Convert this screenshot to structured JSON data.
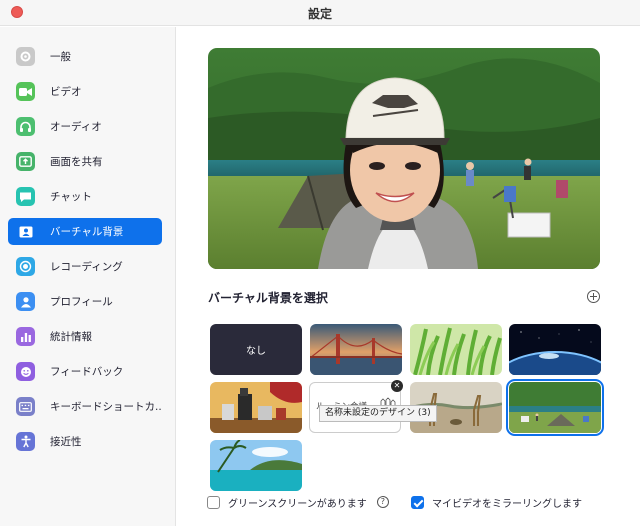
{
  "window": {
    "title": "設定"
  },
  "sidebar": {
    "items": [
      {
        "label": "一般",
        "icon": "gear-icon",
        "color": "#c9c9c9"
      },
      {
        "label": "ビデオ",
        "icon": "video-camera-icon",
        "color": "#55c359"
      },
      {
        "label": "オーディオ",
        "icon": "headphones-icon",
        "color": "#4dbf70"
      },
      {
        "label": "画面を共有",
        "icon": "share-screen-icon",
        "color": "#46b36a"
      },
      {
        "label": "チャット",
        "icon": "chat-bubble-icon",
        "color": "#27c3b1"
      },
      {
        "label": "バーチャル背景",
        "icon": "person-card-icon",
        "color": "#0e71eb"
      },
      {
        "label": "レコーディング",
        "icon": "record-icon",
        "color": "#2ea8e6"
      },
      {
        "label": "プロフィール",
        "icon": "profile-icon",
        "color": "#3c8ff2"
      },
      {
        "label": "統計情報",
        "icon": "statistics-icon",
        "color": "#9a68e0"
      },
      {
        "label": "フィードバック",
        "icon": "feedback-smile-icon",
        "color": "#8f5fe0"
      },
      {
        "label": "キーボードショートカ...",
        "icon": "keyboard-icon",
        "color": "#7a80c9"
      },
      {
        "label": "接近性",
        "icon": "accessibility-icon",
        "color": "#6674d6"
      }
    ],
    "active_index": 5
  },
  "main": {
    "section_title": "バーチャル背景を選択",
    "backgrounds": [
      {
        "label": "なし",
        "kind": "none"
      },
      {
        "label": "",
        "kind": "golden-gate-bridge"
      },
      {
        "label": "",
        "kind": "grass"
      },
      {
        "label": "",
        "kind": "earth-from-space"
      },
      {
        "label": "",
        "kind": "camping-coffee"
      },
      {
        "label": "ルーミン会議",
        "kind": "custom-design"
      },
      {
        "label": "",
        "kind": "savanna-giraffes"
      },
      {
        "label": "",
        "kind": "campsite-selected"
      },
      {
        "label": "",
        "kind": "tropical-beach"
      }
    ],
    "selected_index": 7,
    "tooltip": "名称未設定のデザイン (3)",
    "remove_glyph": "✕"
  },
  "options": {
    "green_screen_label": "グリーンスクリーンがあります",
    "green_screen_checked": false,
    "mirror_label": "マイビデオをミラーリングします",
    "mirror_checked": true,
    "help_glyph": "?"
  },
  "colors": {
    "accent": "#0e71eb",
    "close": "#ee5b57"
  }
}
